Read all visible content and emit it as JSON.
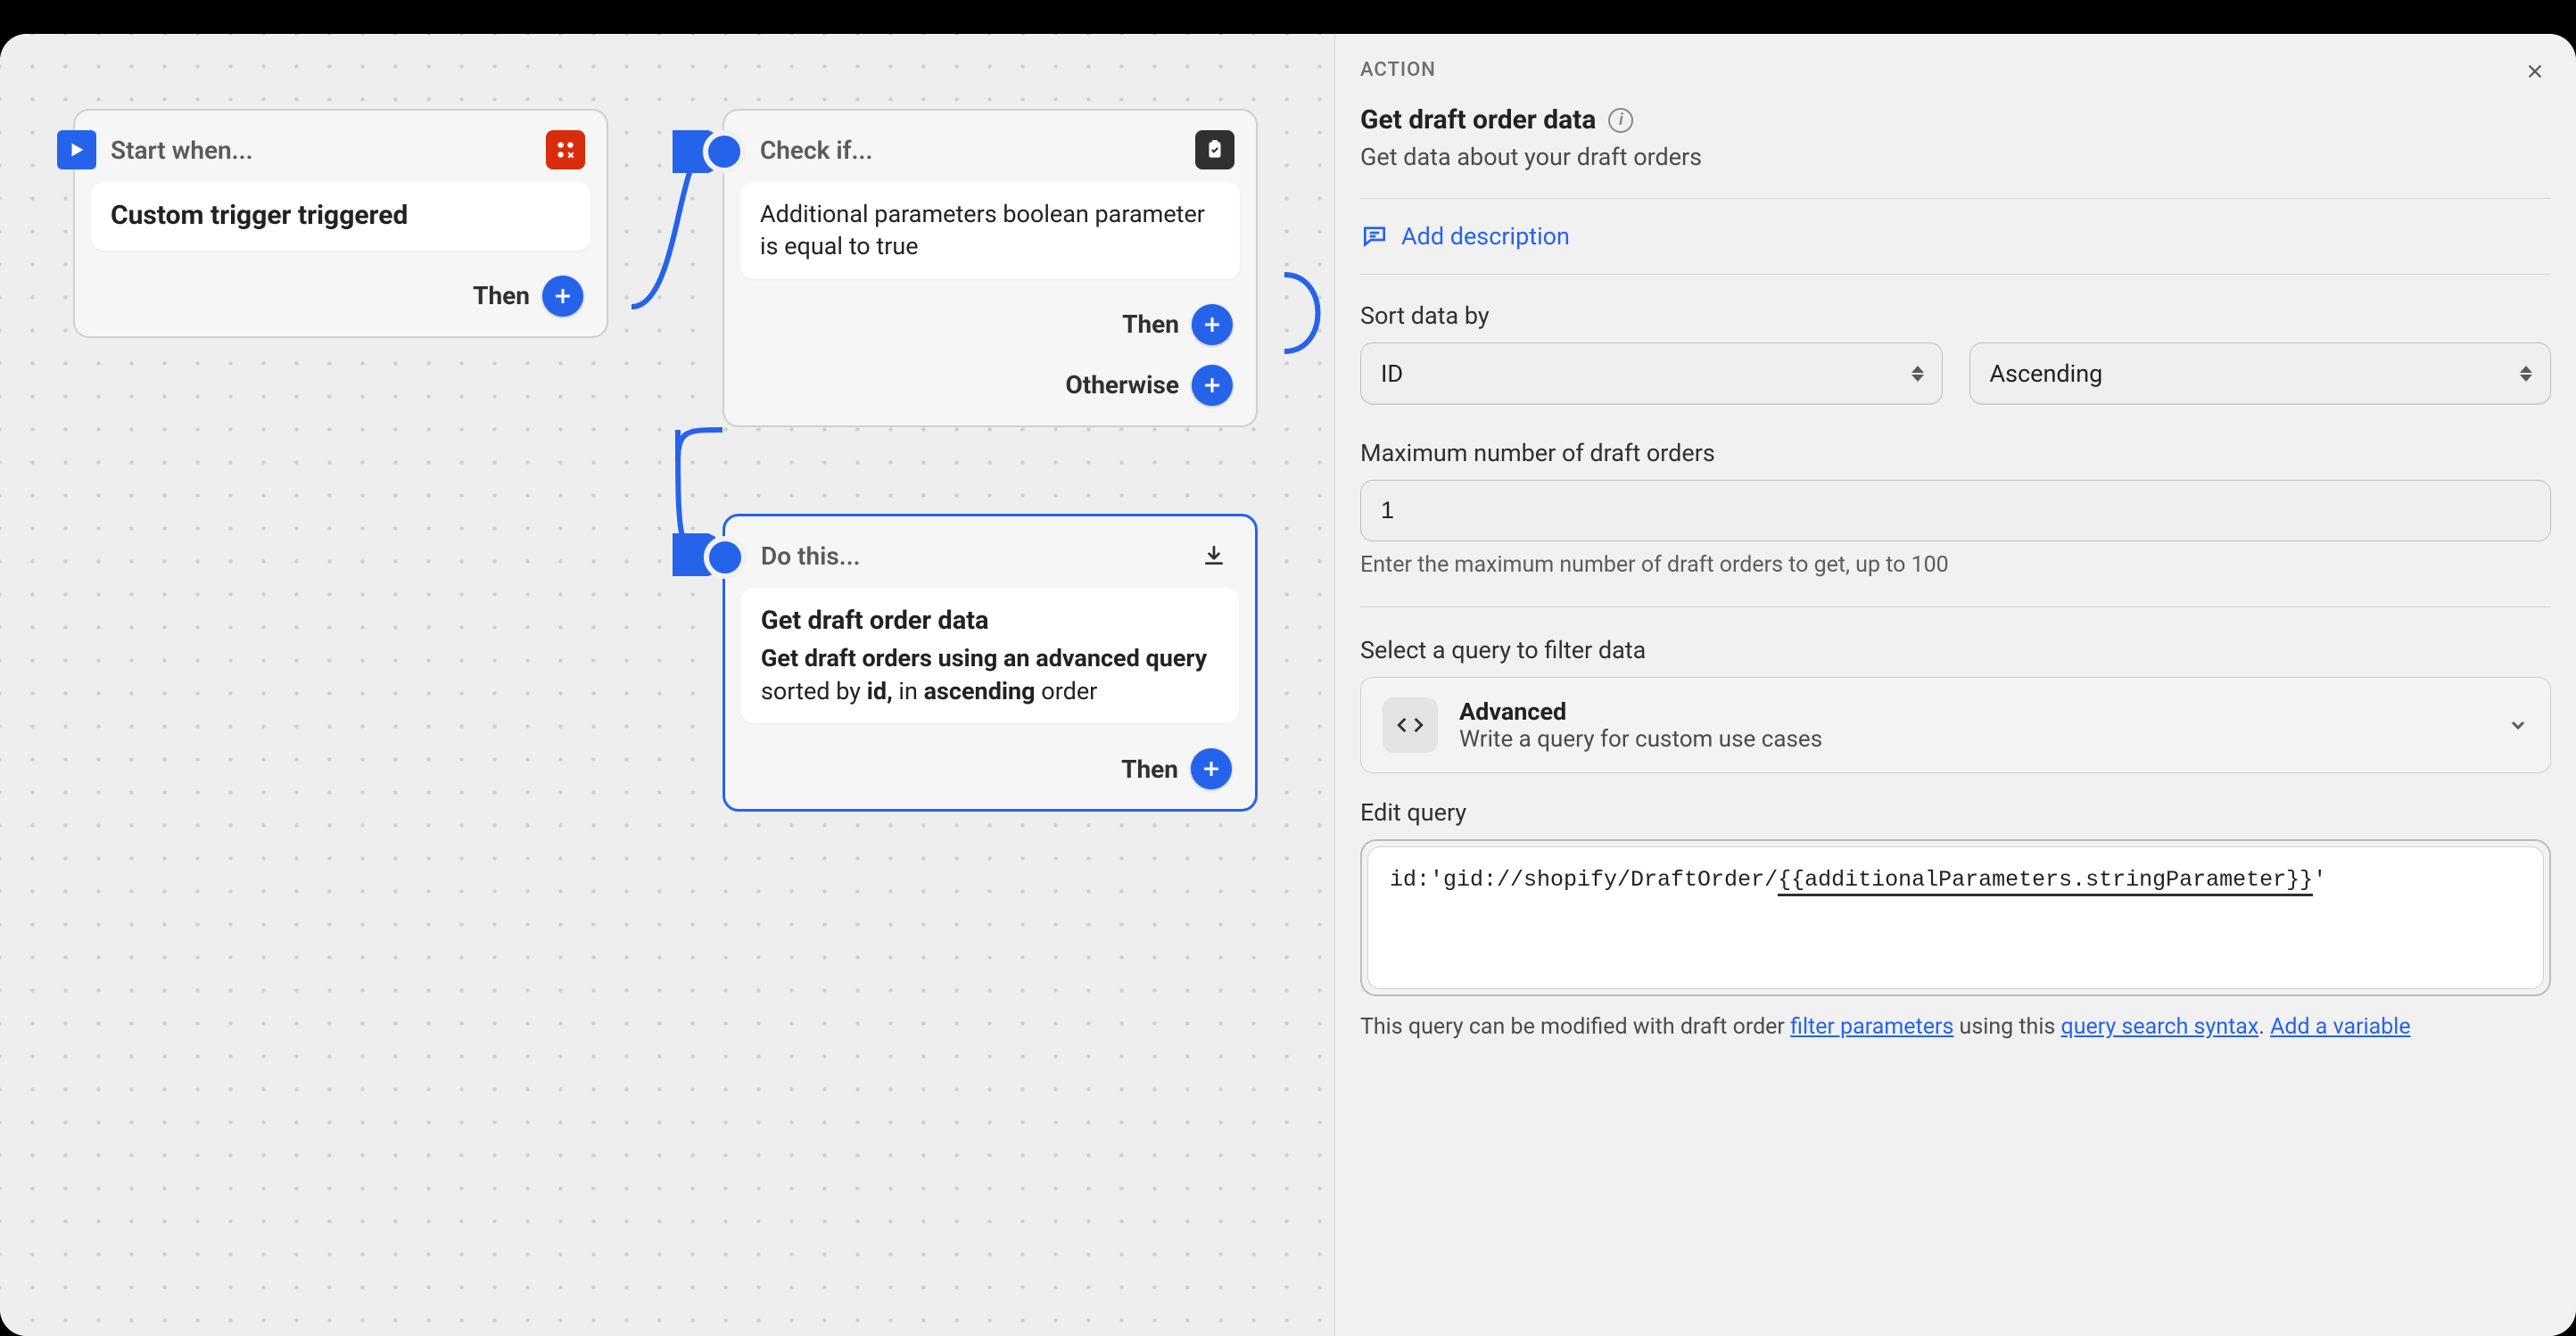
{
  "canvas": {
    "trigger": {
      "header": "Start when...",
      "body": "Custom trigger triggered",
      "then": "Then"
    },
    "check": {
      "header": "Check if...",
      "body": "Additional parameters boolean parameter is equal to true",
      "then": "Then",
      "otherwise": "Otherwise"
    },
    "action": {
      "header": "Do this...",
      "title": "Get draft order data",
      "desc_prefix": "Get draft orders using an advanced query",
      "desc_sorted": " sorted by ",
      "desc_id": "id,",
      "desc_in": " in ",
      "desc_asc": "ascending",
      "desc_order": " order",
      "then": "Then"
    }
  },
  "panel": {
    "kicker": "ACTION",
    "title": "Get draft order data",
    "subtitle": "Get data about your draft orders",
    "add_description": "Add description",
    "sort_label": "Sort data by",
    "sort_field": "ID",
    "sort_dir": "Ascending",
    "max_label": "Maximum number of draft orders",
    "max_value": "1",
    "max_hint": "Enter the maximum number of draft orders to get, up to 100",
    "query_select_label": "Select a query to filter data",
    "query_card": {
      "title": "Advanced",
      "desc": "Write a query for custom use cases"
    },
    "edit_query_label": "Edit query",
    "editor_prefix": "id:'gid://shopify/DraftOrder/",
    "editor_token": "{{additionalParameters.stringParameter}}",
    "editor_suffix": "'",
    "foot_text1": "This query can be modified with draft order ",
    "foot_link1": "filter parameters",
    "foot_text2": " using this ",
    "foot_link2": "query search syntax",
    "foot_text3": ".",
    "foot_addvar": "Add a variable"
  }
}
